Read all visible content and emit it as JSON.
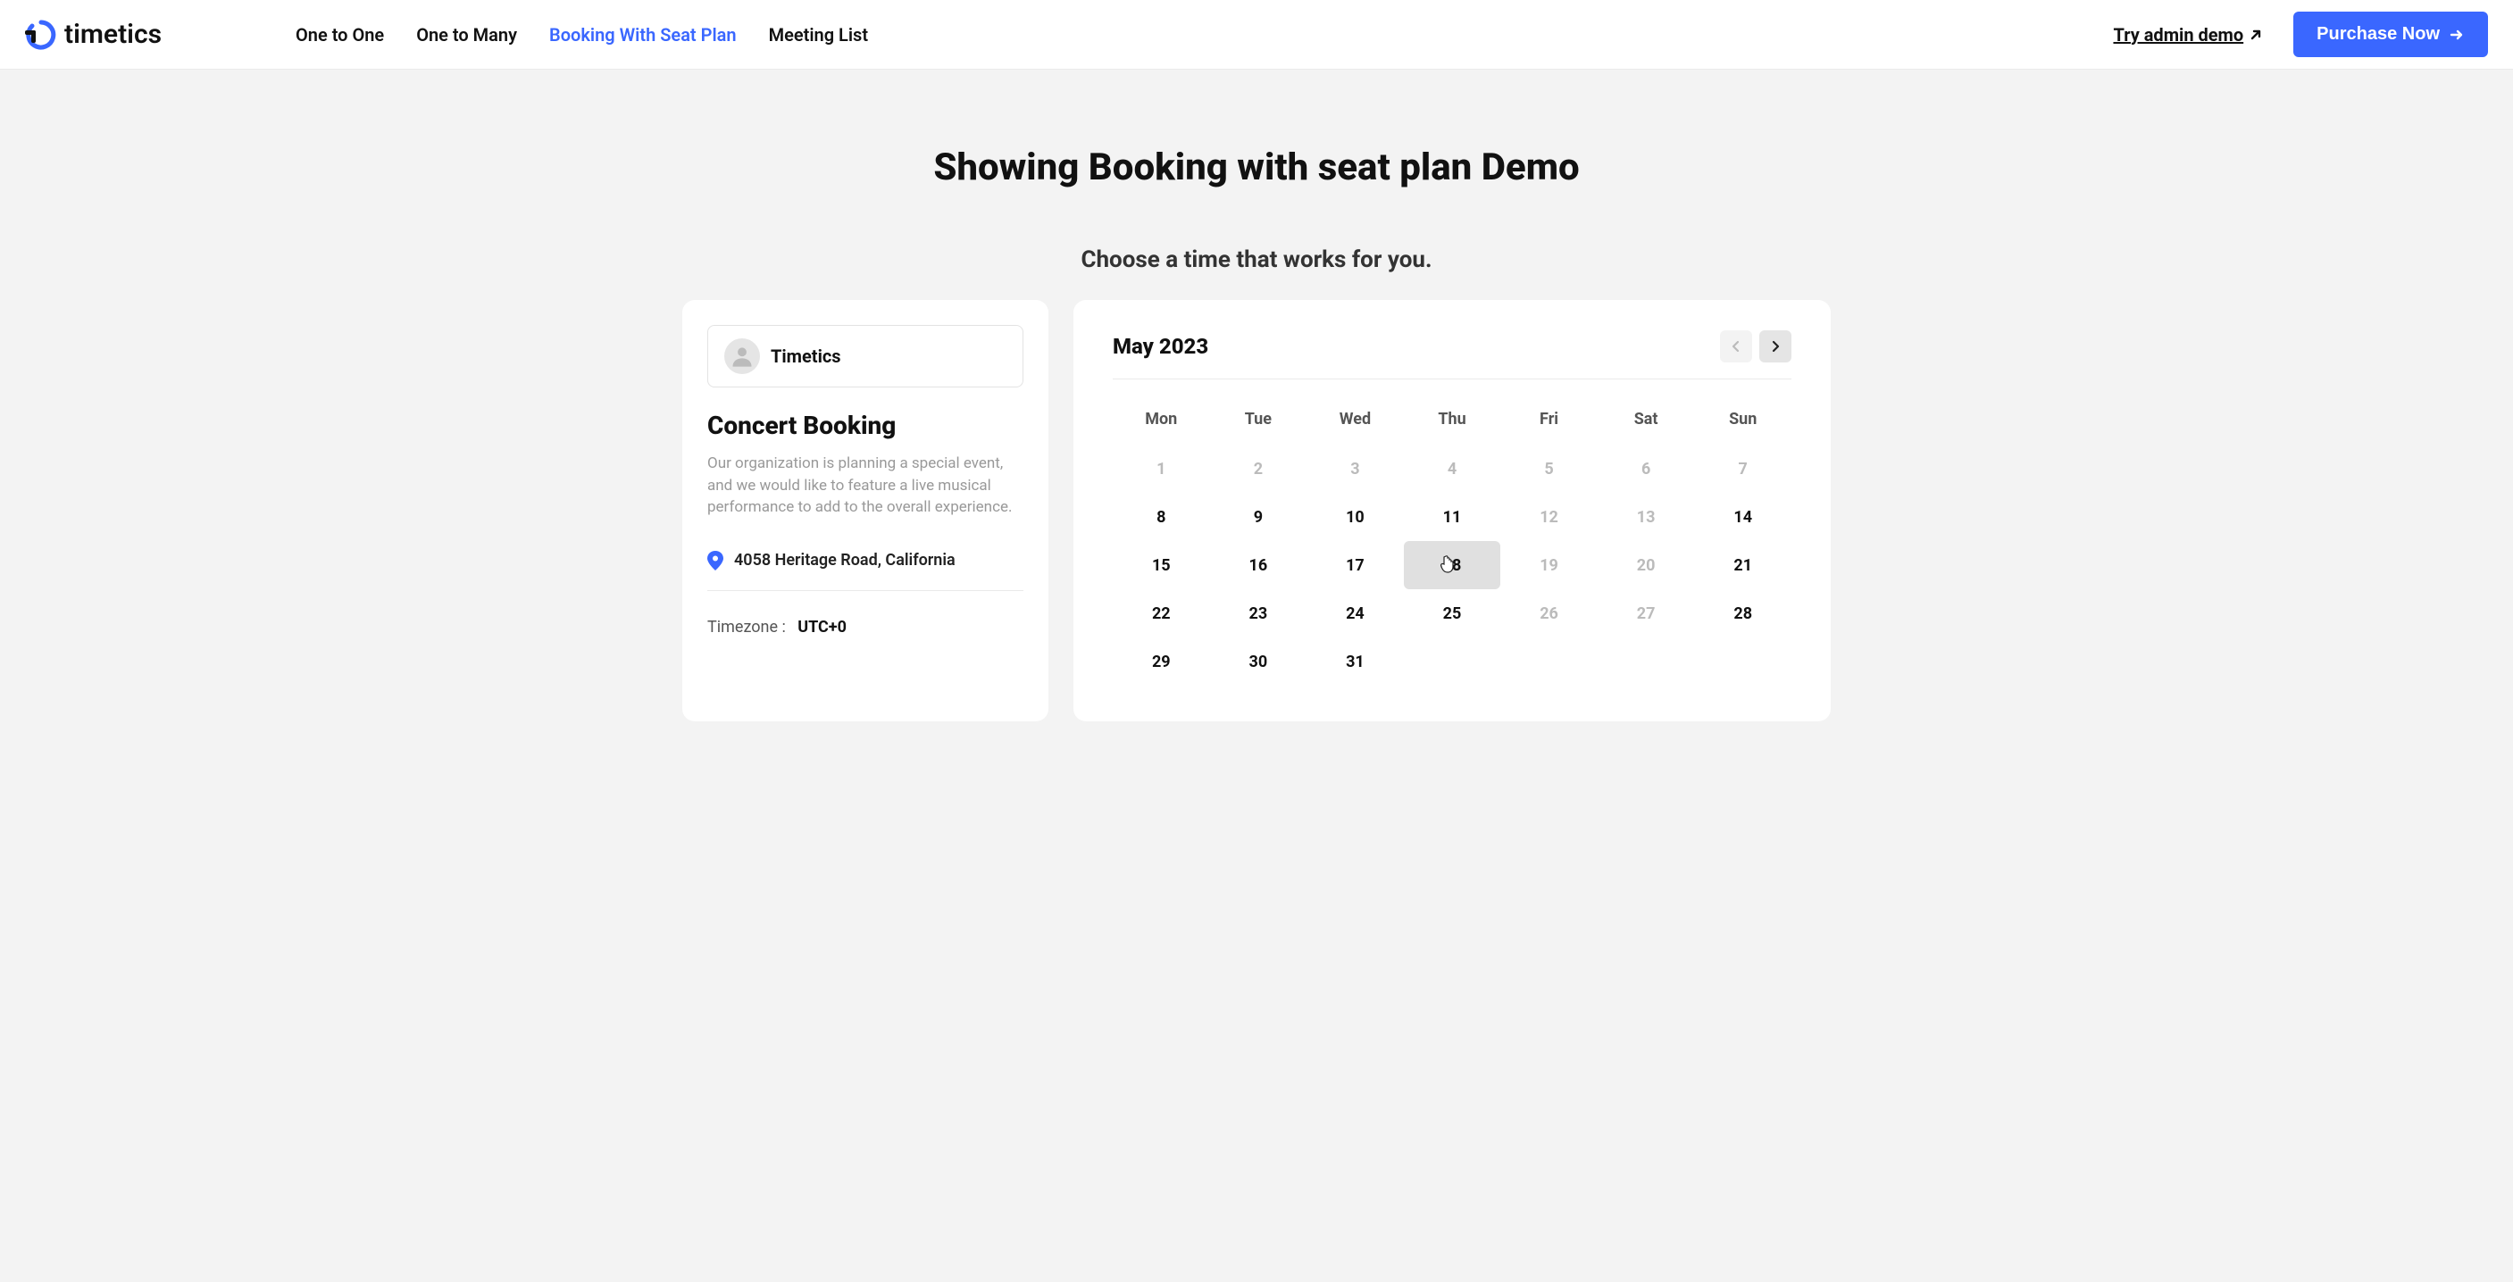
{
  "header": {
    "brand": "timetics",
    "nav": [
      {
        "label": "One to One",
        "active": false
      },
      {
        "label": "One to Many",
        "active": false
      },
      {
        "label": "Booking With Seat Plan",
        "active": true
      },
      {
        "label": "Meeting List",
        "active": false
      }
    ],
    "try_demo": "Try admin demo",
    "purchase": "Purchase Now"
  },
  "page": {
    "title": "Showing Booking with seat plan Demo",
    "subtitle": "Choose a time that works for you."
  },
  "event": {
    "organizer": "Timetics",
    "title": "Concert Booking",
    "description": "Our organization is planning a special event, and we would like to feature a live musical performance to add to the overall experience.",
    "location": "4058 Heritage Road, California",
    "timezone_label": "Timezone :",
    "timezone_value": "UTC+0"
  },
  "calendar": {
    "month_label": "May 2023",
    "days_of_week": [
      "Mon",
      "Tue",
      "Wed",
      "Thu",
      "Fri",
      "Sat",
      "Sun"
    ],
    "weeks": [
      [
        {
          "d": "1",
          "dim": true
        },
        {
          "d": "2",
          "dim": true
        },
        {
          "d": "3",
          "dim": true
        },
        {
          "d": "4",
          "dim": true
        },
        {
          "d": "5",
          "dim": true
        },
        {
          "d": "6",
          "dim": true
        },
        {
          "d": "7",
          "dim": true
        }
      ],
      [
        {
          "d": "8",
          "dim": false
        },
        {
          "d": "9",
          "dim": false
        },
        {
          "d": "10",
          "dim": false
        },
        {
          "d": "11",
          "dim": false
        },
        {
          "d": "12",
          "dim": true
        },
        {
          "d": "13",
          "dim": true
        },
        {
          "d": "14",
          "dim": false
        }
      ],
      [
        {
          "d": "15",
          "dim": false
        },
        {
          "d": "16",
          "dim": false
        },
        {
          "d": "17",
          "dim": false
        },
        {
          "d": "18",
          "dim": false,
          "hovered": true
        },
        {
          "d": "19",
          "dim": true
        },
        {
          "d": "20",
          "dim": true
        },
        {
          "d": "21",
          "dim": false
        }
      ],
      [
        {
          "d": "22",
          "dim": false
        },
        {
          "d": "23",
          "dim": false
        },
        {
          "d": "24",
          "dim": false
        },
        {
          "d": "25",
          "dim": false
        },
        {
          "d": "26",
          "dim": true
        },
        {
          "d": "27",
          "dim": true
        },
        {
          "d": "28",
          "dim": false
        }
      ],
      [
        {
          "d": "29",
          "dim": false
        },
        {
          "d": "30",
          "dim": false
        },
        {
          "d": "31",
          "dim": false
        },
        {
          "d": "",
          "dim": true
        },
        {
          "d": "",
          "dim": true
        },
        {
          "d": "",
          "dim": true
        },
        {
          "d": "",
          "dim": true
        }
      ]
    ]
  }
}
